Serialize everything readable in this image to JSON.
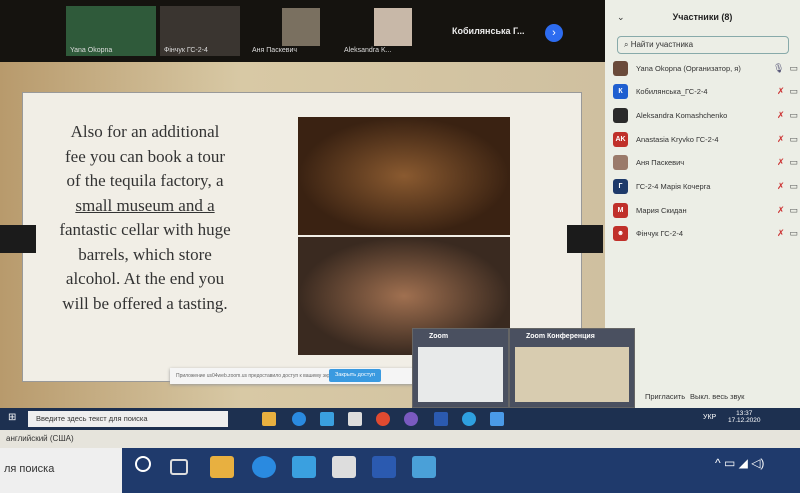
{
  "videos": [
    {
      "name": "Yana Okopna"
    },
    {
      "name": "Фінчук ГС-2-4"
    },
    {
      "name": "Аня Паскевич"
    },
    {
      "name": "Aleksandra K..."
    }
  ],
  "video_overflow_name": "Кобилянська Г...",
  "slide": {
    "lines": [
      "Also for an additional",
      "fee you can book a tour",
      "of the tequila factory, a",
      "small museum and a",
      "fantastic cellar with huge",
      "barrels, which store",
      "alcohol. At the end you",
      "will be offered a tasting."
    ]
  },
  "share_notice": {
    "text": "Приложение us04web.zoom.us предоставило доступ к вашему экрану.",
    "button": "Закрыть доступ"
  },
  "participants": {
    "title": "Участники (8)",
    "search_placeholder": "Найти участника",
    "items": [
      {
        "name": "Yana Okopna (Организатор, я)",
        "initials": "",
        "color": "#6a4a3a"
      },
      {
        "name": "Кобилянська_ГС-2-4",
        "initials": "К",
        "color": "#1f5fd0"
      },
      {
        "name": "Aleksandra Komashchenko",
        "initials": "",
        "color": "#2a2a2a"
      },
      {
        "name": "Anastasia Kryvko ГС-2-4",
        "initials": "AK",
        "color": "#c0302a"
      },
      {
        "name": "Аня Паскевич",
        "initials": "",
        "color": "#9a7a6a"
      },
      {
        "name": "ГС-2-4 Марія Кочерга",
        "initials": "Г",
        "color": "#1e3a6a"
      },
      {
        "name": "Мария Скидан",
        "initials": "М",
        "color": "#c0302a"
      },
      {
        "name": "Фінчук ГС-2-4",
        "initials": "☻",
        "color": "#c0302a"
      }
    ],
    "invite": "Пригласить",
    "mute_all": "Выкл. весь звук"
  },
  "popups": [
    {
      "title": "Zoom"
    },
    {
      "title": "Zoom Конференция"
    }
  ],
  "inner_taskbar": {
    "search": "Введите здесь текст для поиска",
    "lang": "УКР",
    "time": "13:37",
    "date": "17.12.2020"
  },
  "status_bar": {
    "language": "английский (США)"
  },
  "outer_taskbar": {
    "search": "ля поиска"
  }
}
